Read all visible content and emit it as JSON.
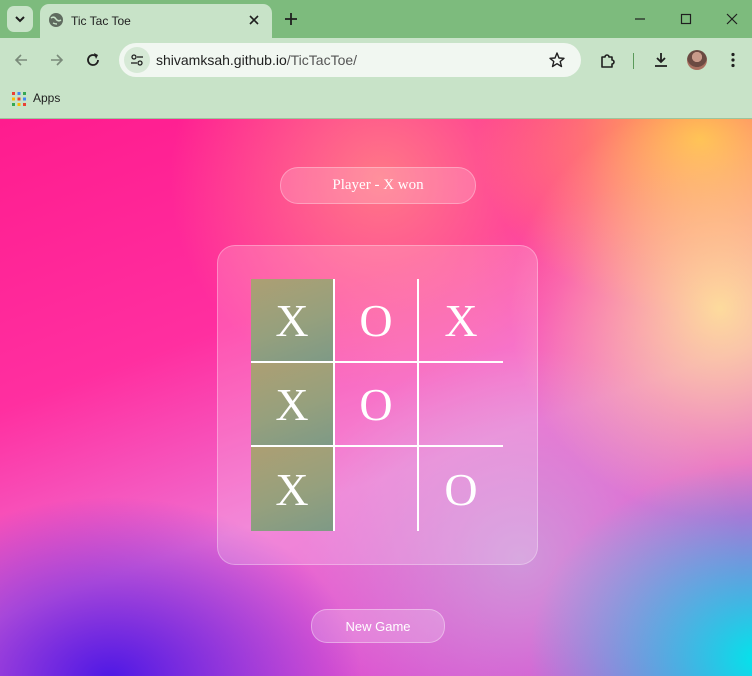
{
  "browser": {
    "tab_title": "Tic Tac Toe",
    "url_host": "shivamksah.github.io",
    "url_path": "/TicTacToe/",
    "bookmarks": {
      "apps_label": "Apps"
    }
  },
  "game": {
    "status": "Player - X won",
    "new_game_label": "New Game",
    "board": [
      [
        "X",
        "O",
        "X"
      ],
      [
        "X",
        "O",
        ""
      ],
      [
        "X",
        "",
        "O"
      ]
    ],
    "winning_cells": [
      "0-0",
      "1-0",
      "2-0"
    ]
  },
  "colors": {
    "chrome_green": "#7dbb7d",
    "toolbar_green": "#c8e3c8",
    "winning_cell": "#9fa07a"
  }
}
